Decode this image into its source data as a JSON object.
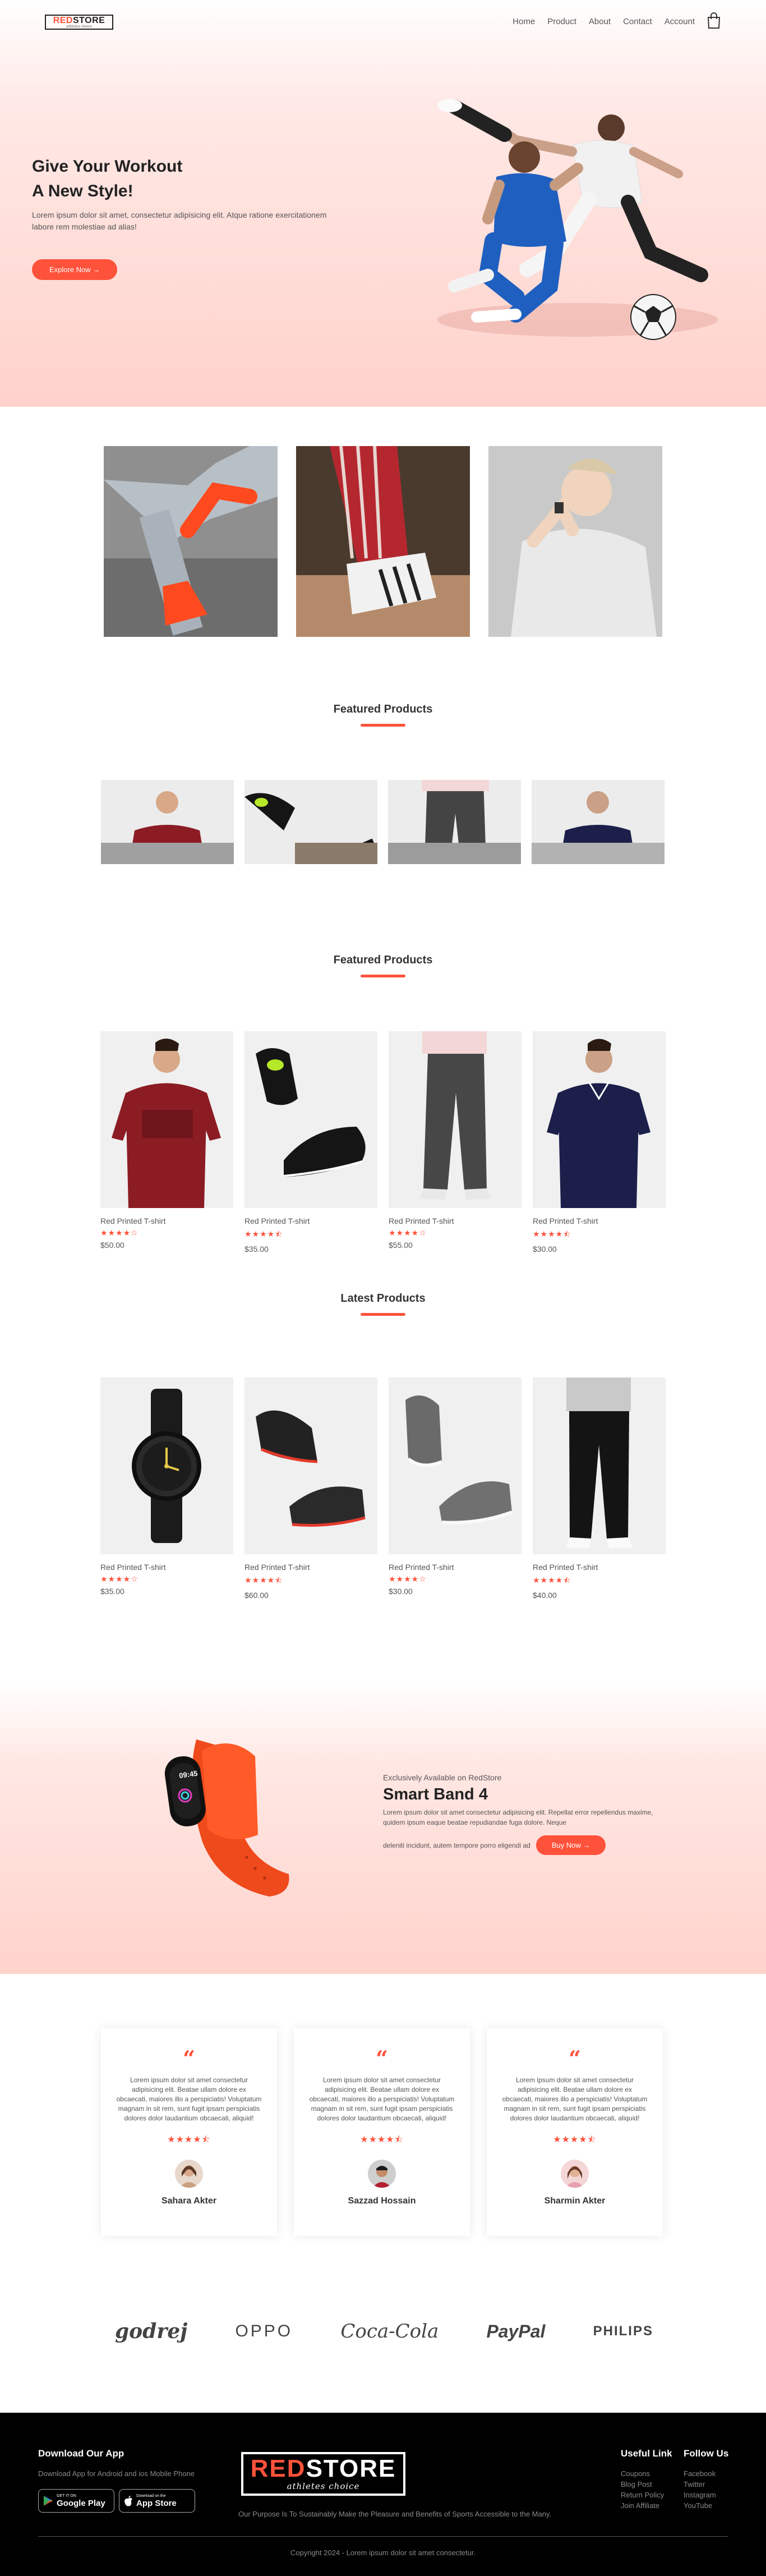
{
  "nav": {
    "logo_red": "RED",
    "logo_black": "STORE",
    "logo_tagline": "athletes choice",
    "menu": [
      "Home",
      "Product",
      "About",
      "Contact",
      "Account"
    ]
  },
  "hero": {
    "title_line1": "Give Your Workout",
    "title_line2": "A New Style!",
    "description": "Lorem ipsum dolor sit amet, consectetur adipisicing elit. Atque ratione exercitationem labore rem molestiae ad alias!",
    "button": "Explore Now →"
  },
  "featured_title_1": "Featured Products",
  "featured_title_2": "Featured Products",
  "latest_title": "Latest Products",
  "featured_products": [
    {
      "name": "Red Printed T-shirt",
      "rating": "★★★★☆",
      "price": "$50.00"
    },
    {
      "name": "Red Printed T-shirt",
      "rating": "★★★★⯪",
      "price": "$35.00"
    },
    {
      "name": "Red Printed T-shirt",
      "rating": "★★★★☆",
      "price": "$55.00"
    },
    {
      "name": "Red Printed T-shirt",
      "rating": "★★★★⯪",
      "price": "$30.00"
    }
  ],
  "latest_products": [
    {
      "name": "Red Printed T-shirt",
      "rating": "★★★★☆",
      "price": "$35.00"
    },
    {
      "name": "Red Printed T-shirt",
      "rating": "★★★★⯪",
      "price": "$60.00"
    },
    {
      "name": "Red Printed T-shirt",
      "rating": "★★★★☆",
      "price": "$30.00"
    },
    {
      "name": "Red Printed T-shirt",
      "rating": "★★★★⯪",
      "price": "$40.00"
    }
  ],
  "offer": {
    "subtitle": "Exclusively Available on RedStore",
    "title": "Smart Band 4",
    "description": "Lorem ipsum dolor sit amet consectetur adipisicing elit. Repellat error repellendus maxime, quidem ipsum eaque beatae repudiandae fuga dolore. Neque",
    "description2": "deleniti incidunt, autem tempore porro eligendi ad",
    "button": "Buy Now →",
    "watch_time": "09:45"
  },
  "testimonials": [
    {
      "text": "Lorem ipsum dolor sit amet consectetur adipisicing elit. Beatae ullam dolore ex obcaecati, maiores illo a perspiciatis! Voluptatum magnam in sit rem, sunt fugit ipsam perspiciatis dolores dolor laudantium obcaecati, aliquid!",
      "rating": "★★★★⯪",
      "name": "Sahara Akter"
    },
    {
      "text": "Lorem ipsum dolor sit amet consectetur adipisicing elit. Beatae ullam dolore ex obcaecati, maiores illo a perspiciatis! Voluptatum magnam in sit rem, sunt fugit ipsam perspiciatis dolores dolor laudantium obcaecati, aliquid!",
      "rating": "★★★★⯪",
      "name": "Sazzad Hossain"
    },
    {
      "text": "Lorem ipsum dolor sit amet consectetur adipisicing elit. Beatae ullam dolore ex obcaecati, maiores illo a perspiciatis! Voluptatum magnam in sit rem, sunt fugit ipsam perspiciatis dolores dolor laudantium obcaecati, aliquid!",
      "rating": "★★★★⯪",
      "name": "Sharmin Akter"
    }
  ],
  "brands": [
    "godrej",
    "OPPO",
    "Coca-Cola",
    "PayPal",
    "PHILIPS"
  ],
  "footer": {
    "app_title": "Download Our App",
    "app_desc": "Download App for Android and ios Mobile Phone",
    "google_small": "GET IT ON",
    "google_big": "Google Play",
    "apple_small": "Download on the",
    "apple_big": "App Store",
    "logo_red": "RED",
    "logo_white": "STORE",
    "logo_tagline": "athletes choice",
    "purpose": "Our Purpose Is To Sustainably Make the Pleasure and Benefits of Sports Accessible to the Many.",
    "useful_title": "Useful Link",
    "useful_links": [
      "Coupons",
      "Blog Post",
      "Return Policy",
      "Join Affiliate"
    ],
    "follow_title": "Follow Us",
    "follow_links": [
      "Facebook",
      "Twitter",
      "Instagram",
      "YouTube"
    ],
    "copyright": "Copyright 2024 - Lorem ipsum dolor sit amet consectetur."
  },
  "colors": {
    "accent": "#ff523b",
    "hero_bg": "#ffd2cb",
    "footer_bg": "#000000"
  }
}
